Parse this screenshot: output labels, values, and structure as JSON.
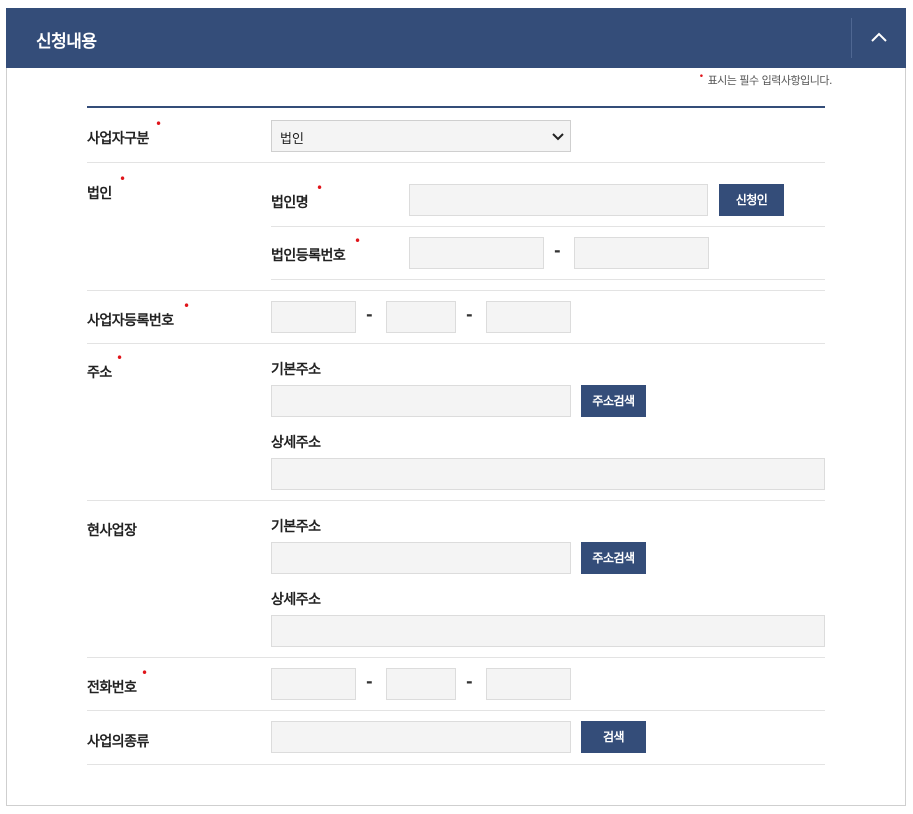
{
  "header": {
    "title": "신청내용"
  },
  "required_note": {
    "marker": "•",
    "text": "표시는 필수 입력사항입니다."
  },
  "business_type": {
    "label": "사업자구분",
    "selected": "법인"
  },
  "corporation": {
    "label": "법인",
    "name_label": "법인명",
    "applicant_button": "신청인",
    "reg_no_label": "법인등록번호"
  },
  "business_reg_no": {
    "label": "사업자등록번호"
  },
  "address": {
    "label": "주소",
    "basic_label": "기본주소",
    "search_button": "주소검색",
    "detail_label": "상세주소"
  },
  "site": {
    "label": "현사업장",
    "basic_label": "기본주소",
    "search_button": "주소검색",
    "detail_label": "상세주소"
  },
  "phone": {
    "label": "전화번호"
  },
  "business_category": {
    "label": "사업의종류",
    "search_button": "검색"
  },
  "symbols": {
    "dash": "-",
    "required": "•"
  },
  "colors": {
    "accent": "#344d79",
    "required": "#e0141a",
    "field_bg": "#f4f4f4"
  },
  "icons": {
    "collapse": "chevron-up-icon",
    "select": "chevron-down-icon"
  }
}
